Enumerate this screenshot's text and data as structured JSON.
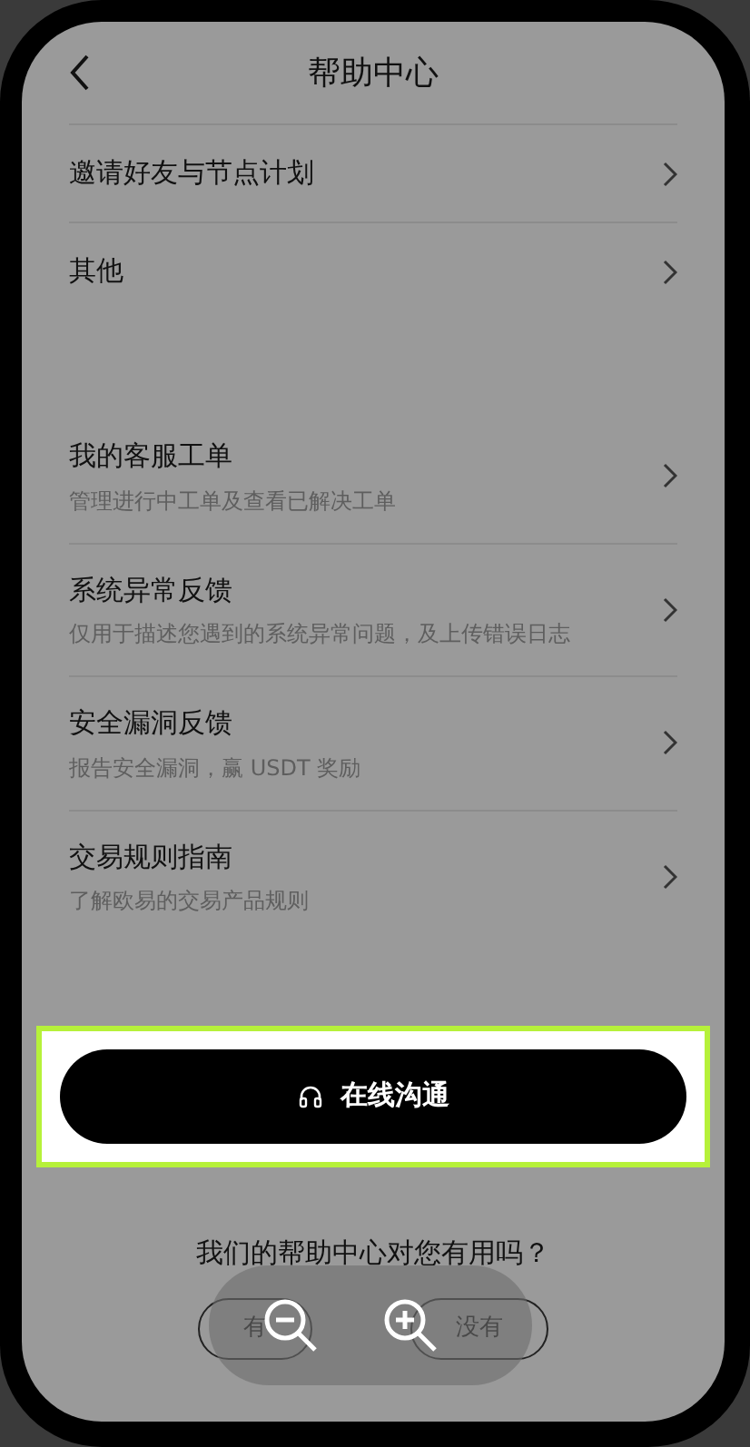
{
  "header": {
    "title": "帮助中心"
  },
  "sections": [
    {
      "items": [
        {
          "title": "邀请好友与节点计划"
        },
        {
          "title": "其他"
        }
      ]
    },
    {
      "items": [
        {
          "title": "我的客服工单",
          "subtitle": "管理进行中工单及查看已解决工单"
        },
        {
          "title": "系统异常反馈",
          "subtitle": "仅用于描述您遇到的系统异常问题，及上传错误日志"
        },
        {
          "title": "安全漏洞反馈",
          "subtitle": "报告安全漏洞，赢 USDT 奖励"
        },
        {
          "title": "交易规则指南",
          "subtitle": "了解欧易的交易产品规则"
        }
      ]
    }
  ],
  "chat_button": {
    "label": "在线沟通",
    "highlighted": true
  },
  "feedback": {
    "question": "我们的帮助中心对您有用吗？",
    "options": [
      {
        "label": "有"
      },
      {
        "label": "没有"
      }
    ]
  }
}
